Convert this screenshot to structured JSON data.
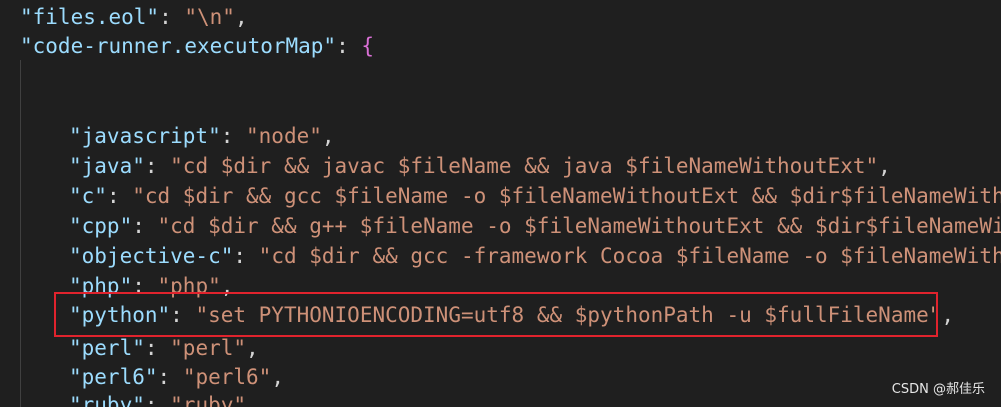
{
  "editor": {
    "background": "#1f1f1f",
    "colors": {
      "key": "#9cdcfe",
      "string": "#ce9178",
      "punctuation": "#d4d4d4",
      "brace": "#da70d6",
      "highlight_border": "#e0232d"
    },
    "lines": [
      {
        "key": "\"files.eol\"",
        "sep": ": ",
        "value": "\"\\n\"",
        "tail": ","
      },
      {
        "key": "\"code-runner.executorMap\"",
        "sep": ": ",
        "value": "",
        "tail": "{"
      },
      {
        "key": "\"javascript\"",
        "sep": ": ",
        "value": "\"node\"",
        "tail": ","
      },
      {
        "key": "\"java\"",
        "sep": ": ",
        "value": "\"cd $dir && javac $fileName && java $fileNameWithoutExt\"",
        "tail": ","
      },
      {
        "key": "\"c\"",
        "sep": ": ",
        "value": "\"cd $dir && gcc $fileName -o $fileNameWithoutExt && $dir$fileNameWithou",
        "tail": ""
      },
      {
        "key": "\"cpp\"",
        "sep": ": ",
        "value": "\"cd $dir && g++ $fileName -o $fileNameWithoutExt && $dir$fileNameWith",
        "tail": ""
      },
      {
        "key": "\"objective-c\"",
        "sep": ": ",
        "value": "\"cd $dir && gcc -framework Cocoa $fileName -o $fileNameWithou",
        "tail": ""
      },
      {
        "key": "\"php\"",
        "sep": ": ",
        "value": "\"php\"",
        "tail": ","
      },
      {
        "key": "\"python\"",
        "sep": ": ",
        "value": "\"set PYTHONIOENCODING=utf8 && $pythonPath -u $fullFileName\"",
        "tail": ","
      },
      {
        "key": "\"perl\"",
        "sep": ": ",
        "value": "\"perl\"",
        "tail": ","
      },
      {
        "key": "\"perl6\"",
        "sep": ": ",
        "value": "\"perl6\"",
        "tail": ","
      },
      {
        "key": "\"ruby\"",
        "sep": ": ",
        "value": "\"ruby\"",
        "tail": ""
      }
    ]
  },
  "watermark": "CSDN @郝佳乐"
}
